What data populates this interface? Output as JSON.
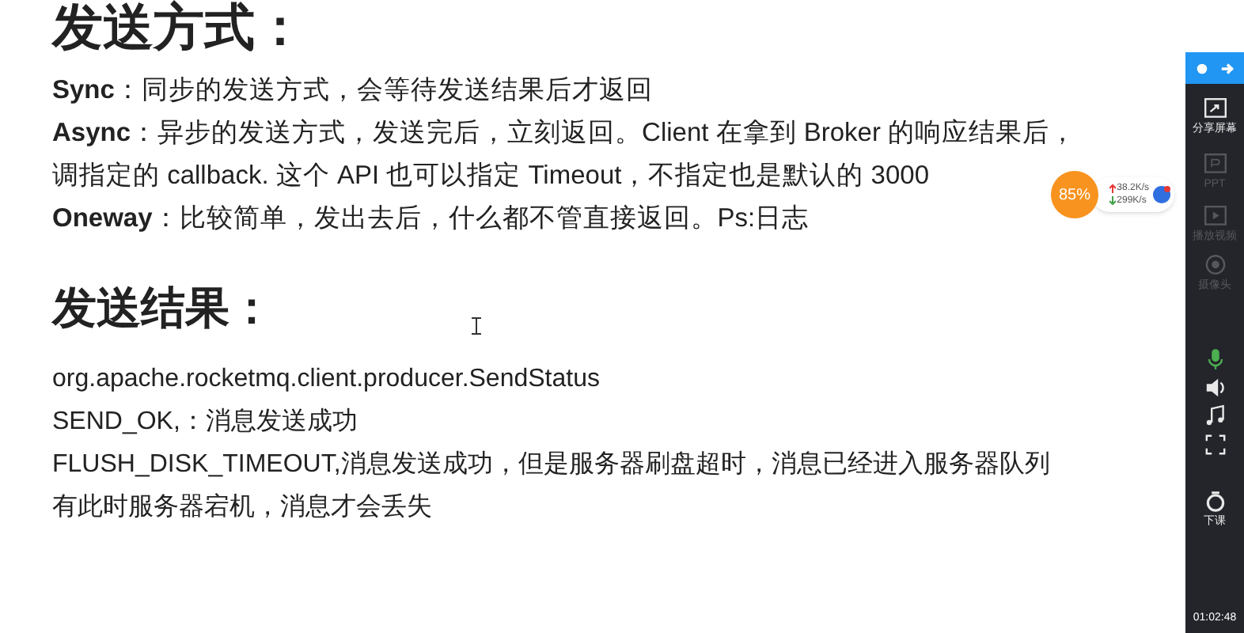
{
  "document": {
    "headings": [
      "发送方式：",
      "发送结果："
    ],
    "section_1": [
      "**Sync**：同步的发送方式，会等待发送结果后才返回",
      "**Async**：异步的发送方式，发送完后，立刻返回。Client 在拿到 Broker 的响应结果后，",
      "调指定的 callback. 这个 API 也可以指定 Timeout，不指定也是默认的 3000",
      "**Oneway**：比较简单，发出去后，什么都不管直接返回。Ps:日志"
    ],
    "section_2": [
      "org.apache.rocketmq.client.producer.SendStatus",
      "SEND_OK,：消息发送成功",
      "FLUSH_DISK_TIMEOUT,消息发送成功，但是服务器刷盘超时，消息已经进入服务器队列",
      "有此时服务器宕机，消息才会丢失"
    ]
  },
  "speed_widget": {
    "percent": "85%",
    "upload": "38.2K/s",
    "download": "299K/s"
  },
  "sidebar": {
    "items": [
      {
        "kind": "share",
        "label": "分享屏幕",
        "disabled": false
      },
      {
        "kind": "ppt",
        "label": "PPT",
        "disabled": true
      },
      {
        "kind": "video",
        "label": "播放视频",
        "disabled": true
      },
      {
        "kind": "camera",
        "label": "摄像头",
        "disabled": true
      },
      {
        "kind": "mic",
        "disabled": false
      },
      {
        "kind": "speaker",
        "disabled": false
      },
      {
        "kind": "music",
        "disabled": false
      },
      {
        "kind": "fullscreen",
        "disabled": false
      },
      {
        "kind": "end",
        "label": "下课",
        "disabled": false
      }
    ],
    "time": "01:02:48"
  }
}
